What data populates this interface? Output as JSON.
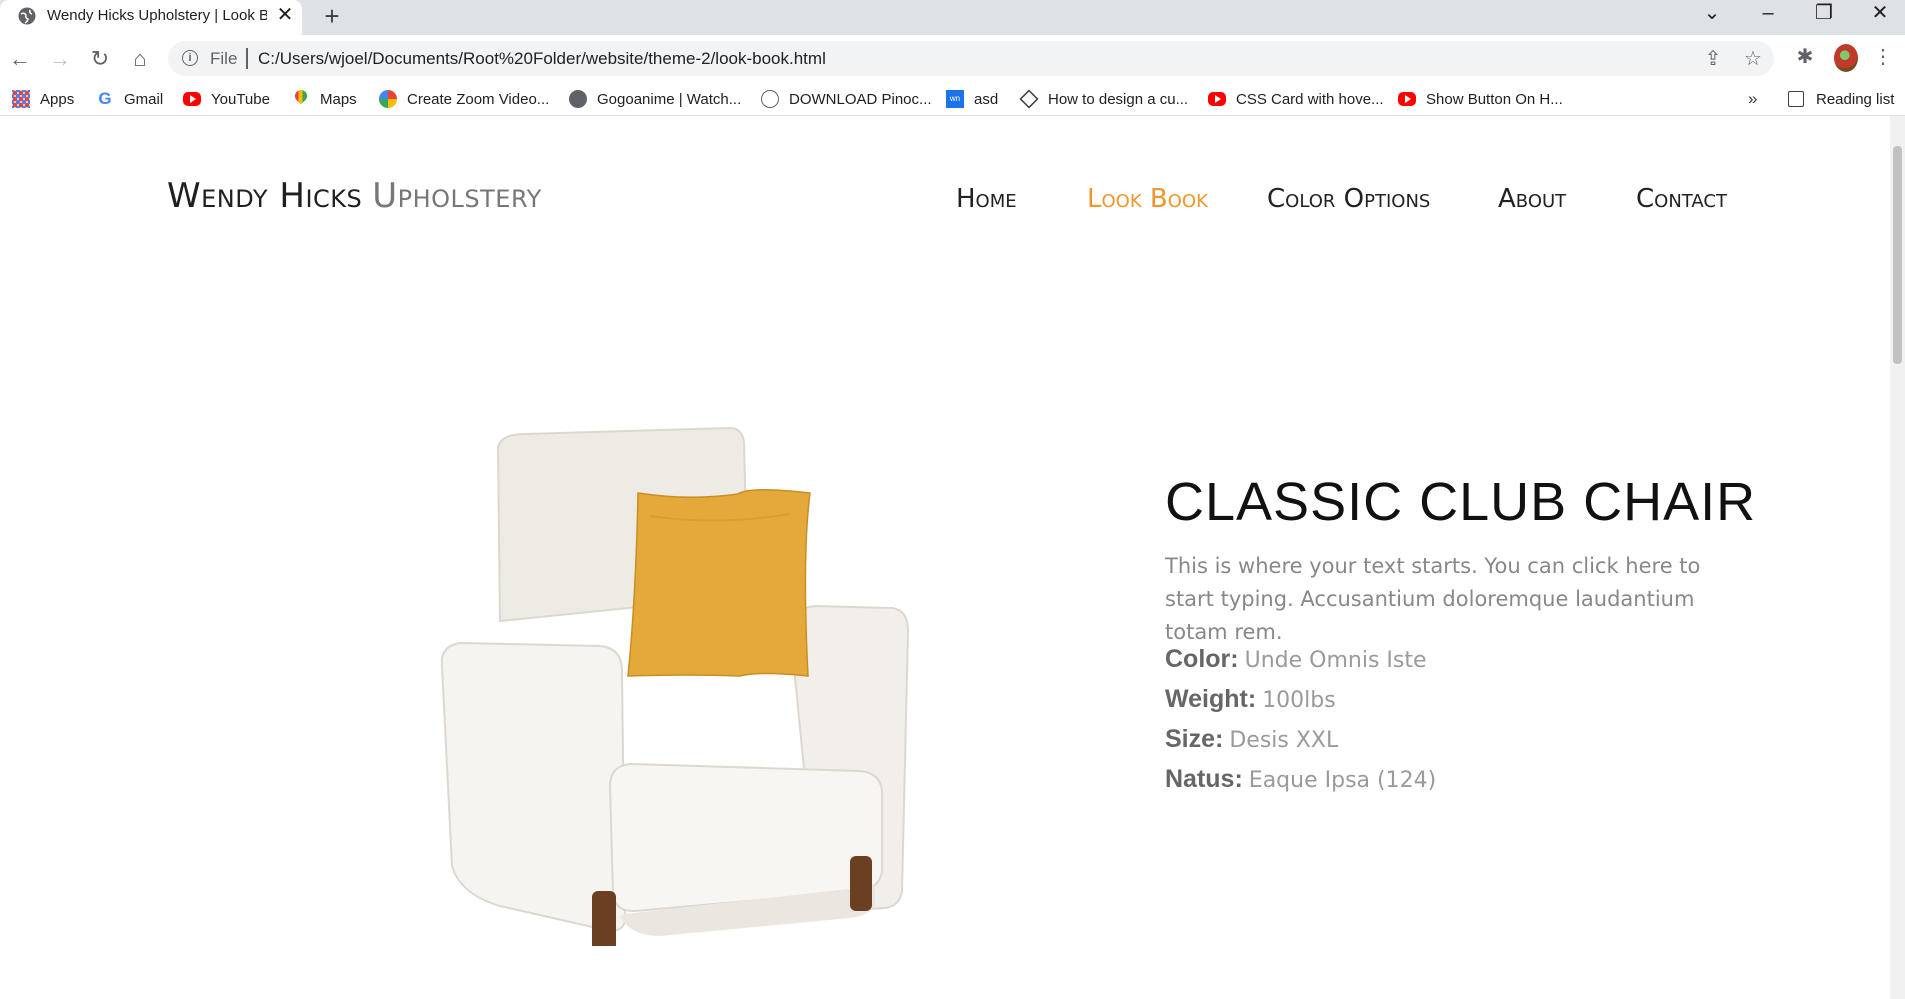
{
  "browser": {
    "tab_title": "Wendy Hicks Upholstery | Look Book",
    "scheme_label": "File",
    "url": "C:/Users/wjoel/Documents/Root%20Folder/website/theme-2/look-book.html",
    "new_tab_glyph": "+",
    "tab_close_glyph": "✕",
    "bookmarks": [
      {
        "label": "Apps",
        "icon": "apps-grid-icon"
      },
      {
        "label": "Gmail",
        "icon": "google-icon"
      },
      {
        "label": "YouTube",
        "icon": "youtube-icon"
      },
      {
        "label": "Maps",
        "icon": "maps-pin-icon"
      },
      {
        "label": "Create Zoom Video...",
        "icon": "chrome-icon"
      },
      {
        "label": "Gogoanime | Watch...",
        "icon": "globe-icon"
      },
      {
        "label": "DOWNLOAD Pinoc...",
        "icon": "camera-icon"
      },
      {
        "label": "asd",
        "icon": "wn-icon"
      },
      {
        "label": "How to design a cu...",
        "icon": "diamond-icon"
      },
      {
        "label": "CSS Card with hove...",
        "icon": "youtube-icon"
      },
      {
        "label": "Show Button On H...",
        "icon": "youtube-icon"
      }
    ],
    "overflow_glyph": "»",
    "reading_list_label": "Reading list"
  },
  "site": {
    "brand_primary": "Wendy Hicks",
    "brand_secondary": "Upholstery",
    "nav": [
      {
        "label": "Home",
        "active": false
      },
      {
        "label": "Look Book",
        "active": true
      },
      {
        "label": "Color Options",
        "active": false
      },
      {
        "label": "About",
        "active": false
      },
      {
        "label": "Contact",
        "active": false
      }
    ],
    "accent_color": "#f0962a"
  },
  "product": {
    "title": "CLASSIC CLUB CHAIR",
    "description": "This is where your text starts. You can click here to start typing. Accusantium doloremque laudantium totam rem.",
    "specs": [
      {
        "label": "Color:",
        "value": "Unde Omnis Iste"
      },
      {
        "label": "Weight:",
        "value": "100lbs"
      },
      {
        "label": "Size:",
        "value": "Desis XXL"
      },
      {
        "label": "Natus:",
        "value": "Eaque Ipsa (124)"
      }
    ],
    "image_alt": "white armchair with yellow pillow"
  }
}
